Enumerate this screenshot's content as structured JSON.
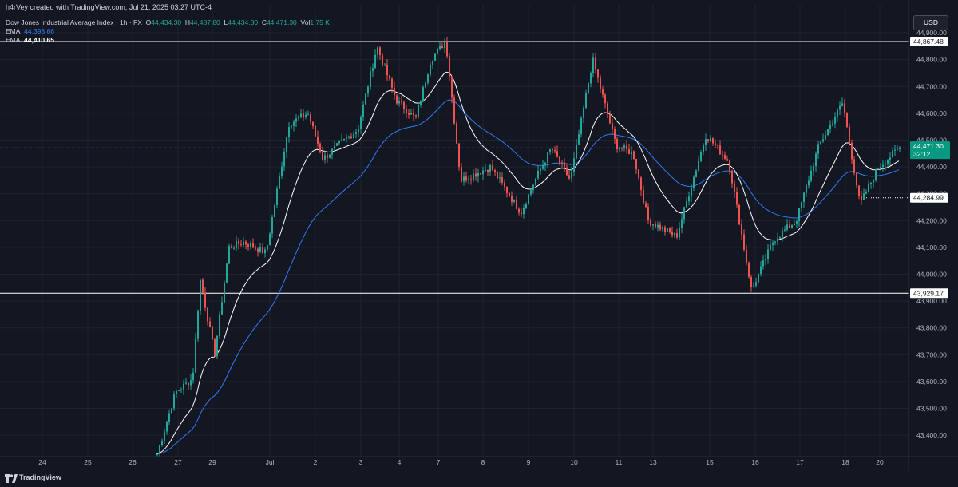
{
  "header": {
    "credit": "h4rVey created with TradingView.com, Jul 21, 2025 03:27 UTC-4",
    "symbol": "Dow Jones Industrial Average Index · 1h · FX",
    "ohlc": {
      "o_label": "O",
      "o": "44,434.30",
      "h_label": "H",
      "h": "44,487.80",
      "l_label": "L",
      "l": "44,434.30",
      "c_label": "C",
      "c": "44,471.30",
      "vol_label": "Vol",
      "vol": "1.75 K"
    },
    "ema1": {
      "label": "EMA",
      "value": "44,393.66"
    },
    "ema2": {
      "label": "EMA",
      "value": "44,410.65"
    }
  },
  "currency_button": "USD",
  "footer": {
    "brand": "TradingView"
  },
  "colors": {
    "background": "#131722",
    "up": "#26a69a",
    "down": "#ef5350",
    "ema_fast": "#ffffff",
    "ema_slow": "#3179f5",
    "current_price_bg": "#089981",
    "current_line": "#9c27b0"
  },
  "chart_data": {
    "type": "candlestick",
    "title": "Dow Jones Industrial Average Index",
    "interval": "1h",
    "exchange": "FX",
    "grid": true,
    "ylim": [
      43320,
      44915
    ],
    "y_ticks": [
      {
        "value": 43400,
        "label": "43,400.00"
      },
      {
        "value": 43500,
        "label": "43,500.00"
      },
      {
        "value": 43600,
        "label": "43,600.00"
      },
      {
        "value": 43700,
        "label": "43,700.00"
      },
      {
        "value": 43800,
        "label": "43,800.00"
      },
      {
        "value": 43900,
        "label": "43,900.00"
      },
      {
        "value": 44000,
        "label": "44,000.00"
      },
      {
        "value": 44100,
        "label": "44,100.00"
      },
      {
        "value": 44200,
        "label": "44,200.00"
      },
      {
        "value": 44300,
        "label": "44,300.00"
      },
      {
        "value": 44400,
        "label": "44,400.00"
      },
      {
        "value": 44500,
        "label": "44,500.00"
      },
      {
        "value": 44600,
        "label": "44,600.00"
      },
      {
        "value": 44700,
        "label": "44,700.00"
      },
      {
        "value": 44800,
        "label": "44,800.00"
      },
      {
        "value": 44900,
        "label": "44,900.00"
      }
    ],
    "x_ticks": [
      "24",
      "25",
      "26",
      "27",
      "29",
      "Jul",
      "2",
      "3",
      "4",
      "7",
      "8",
      "9",
      "10",
      "11",
      "13",
      "15",
      "16",
      "17",
      "18",
      "20"
    ],
    "horizontal_lines": [
      {
        "value": 44867.48,
        "label": "44,867.48",
        "style": "solid"
      },
      {
        "value": 44284.99,
        "label": "44,284.99",
        "style": "dotted"
      },
      {
        "value": 43929.17,
        "label": "43,929.17",
        "style": "solid"
      }
    ],
    "current_price": {
      "value": 44471.3,
      "label": "44,471.30",
      "countdown": "32:12"
    },
    "price_path": [
      {
        "x": "26",
        "y": 43330
      },
      {
        "x": "27",
        "y": 43560
      },
      {
        "x": "27",
        "y": 43610
      },
      {
        "x": "29",
        "y": 43980
      },
      {
        "x": "29",
        "y": 43700
      },
      {
        "x": "29",
        "y": 44100
      },
      {
        "x": "29",
        "y": 44120
      },
      {
        "x": "Jul",
        "y": 44080
      },
      {
        "x": "Jul",
        "y": 44560
      },
      {
        "x": "2",
        "y": 44600
      },
      {
        "x": "2",
        "y": 44430
      },
      {
        "x": "2",
        "y": 44480
      },
      {
        "x": "3",
        "y": 44540
      },
      {
        "x": "3",
        "y": 44850
      },
      {
        "x": "4",
        "y": 44650
      },
      {
        "x": "4",
        "y": 44580
      },
      {
        "x": "7",
        "y": 44800
      },
      {
        "x": "7",
        "y": 44870
      },
      {
        "x": "7",
        "y": 44350
      },
      {
        "x": "8",
        "y": 44400
      },
      {
        "x": "9",
        "y": 44230
      },
      {
        "x": "9",
        "y": 44360
      },
      {
        "x": "9",
        "y": 44470
      },
      {
        "x": "10",
        "y": 44350
      },
      {
        "x": "10",
        "y": 44800
      },
      {
        "x": "11",
        "y": 44480
      },
      {
        "x": "11",
        "y": 44450
      },
      {
        "x": "13",
        "y": 44200
      },
      {
        "x": "13",
        "y": 44140
      },
      {
        "x": "15",
        "y": 44520
      },
      {
        "x": "15",
        "y": 44420
      },
      {
        "x": "16",
        "y": 43940
      },
      {
        "x": "16",
        "y": 44130
      },
      {
        "x": "17",
        "y": 44200
      },
      {
        "x": "17",
        "y": 44480
      },
      {
        "x": "18",
        "y": 44640
      },
      {
        "x": "18",
        "y": 44260
      },
      {
        "x": "20",
        "y": 44400
      },
      {
        "x": "20",
        "y": 44471
      }
    ],
    "series": [
      {
        "name": "EMA",
        "value": 44393.66,
        "color": "#3179f5",
        "role": "slow"
      },
      {
        "name": "EMA",
        "value": 44410.65,
        "color": "#ffffff",
        "role": "fast"
      }
    ]
  }
}
